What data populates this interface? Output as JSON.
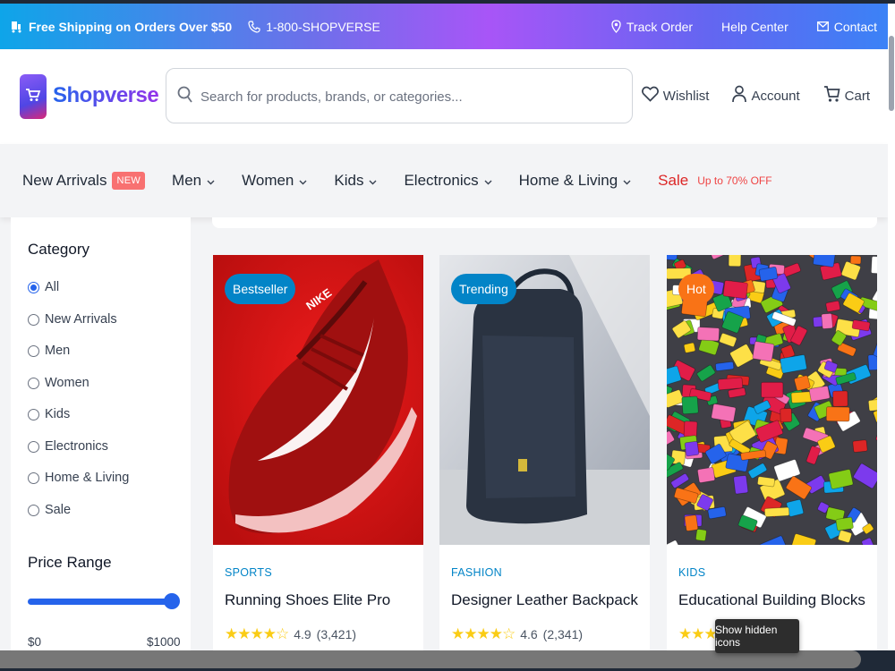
{
  "topbar": {
    "shipping": "Free Shipping on Orders Over $50",
    "phone": "1-800-SHOPVERSE",
    "track": "Track Order",
    "help": "Help Center",
    "contact": "Contact"
  },
  "header": {
    "logo": "Shopverse",
    "search_placeholder": "Search for products, brands, or categories...",
    "wishlist": "Wishlist",
    "account": "Account",
    "cart": "Cart"
  },
  "nav": {
    "items": [
      {
        "label": "New Arrivals",
        "badge": "NEW"
      },
      {
        "label": "Men"
      },
      {
        "label": "Women"
      },
      {
        "label": "Kids"
      },
      {
        "label": "Electronics"
      },
      {
        "label": "Home & Living"
      },
      {
        "label": "Sale",
        "tag": "Up to 70% OFF"
      }
    ]
  },
  "sidebar": {
    "category_title": "Category",
    "categories": [
      "All",
      "New Arrivals",
      "Men",
      "Women",
      "Kids",
      "Electronics",
      "Home & Living",
      "Sale"
    ],
    "selected_category": "All",
    "price_title": "Price Range",
    "price_min": "$0",
    "price_max": "$1000",
    "price_slider_fraction": 1.0
  },
  "products": [
    {
      "badge": "Bestseller",
      "badge_color": "#0284c7",
      "category": "SPORTS",
      "name": "Running Shoes Elite Pro",
      "rating": "4.9",
      "reviews": "(3,421)"
    },
    {
      "badge": "Trending",
      "badge_color": "#0284c7",
      "category": "FASHION",
      "name": "Designer Leather Backpack",
      "rating": "4.6",
      "reviews": "(2,341)"
    },
    {
      "badge": "Hot",
      "badge_color": "#f97316",
      "category": "KIDS",
      "name": "Educational Building Blocks",
      "rating": "",
      "reviews": ""
    }
  ],
  "tooltip": "Show hidden icons",
  "colors": {
    "accent": "#2563eb",
    "sale": "#dc2626",
    "category": "#0284c7",
    "star": "#facc15"
  }
}
